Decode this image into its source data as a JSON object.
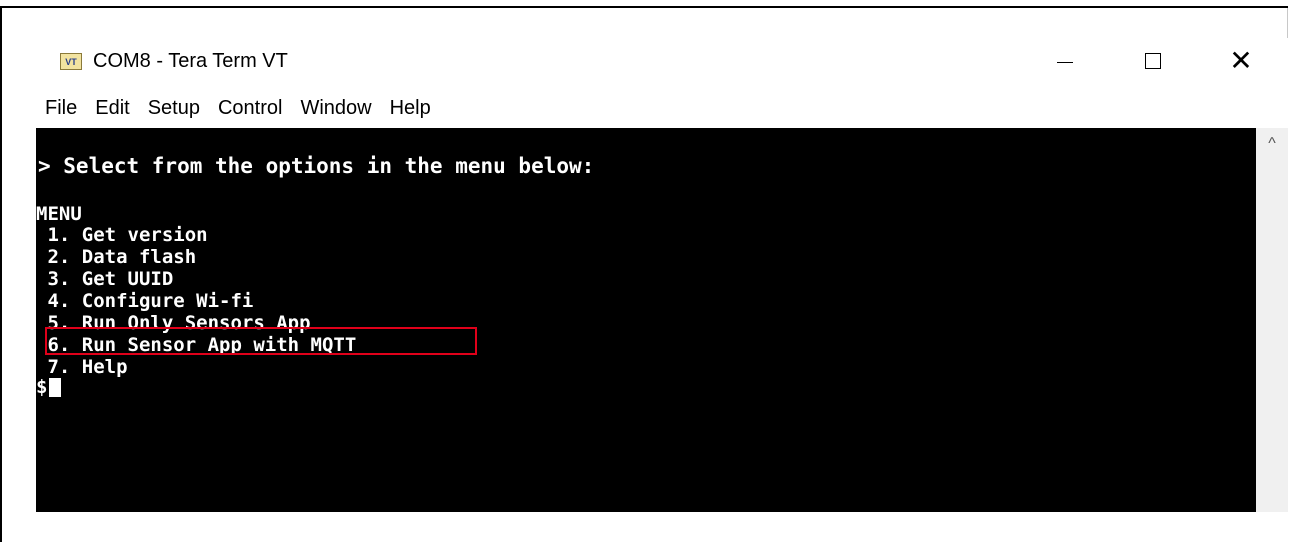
{
  "window": {
    "icon_label": "VT",
    "title": "COM8 - Tera Term VT",
    "controls": {
      "minimize": "—",
      "close": "✕"
    }
  },
  "menubar": {
    "items": [
      "File",
      "Edit",
      "Setup",
      "Control",
      "Window",
      "Help"
    ]
  },
  "terminal": {
    "prompt_line": "> Select from the options in the menu below:",
    "menu_title": "MENU",
    "options": [
      " 1. Get version",
      " 2. Data flash",
      " 3. Get UUID",
      " 4. Configure Wi-fi",
      " 5. Run Only Sensors App",
      " 6. Run Sensor App with MQTT",
      " 7. Help"
    ],
    "shell_prompt": "$",
    "highlighted_option_index": 5,
    "highlight_color": "#e0001a"
  },
  "scrollbar": {
    "up_arrow": "^"
  }
}
